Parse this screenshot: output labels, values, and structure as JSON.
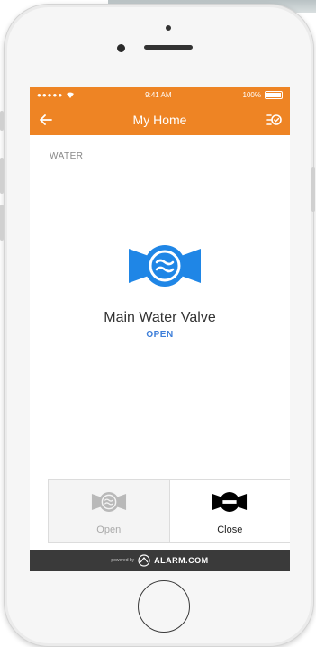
{
  "status_bar": {
    "signal": "●●●●●",
    "time": "9:41 AM",
    "battery": "100%"
  },
  "navbar": {
    "title": "My Home"
  },
  "section_label": "WATER",
  "device": {
    "name": "Main Water Valve",
    "state": "OPEN"
  },
  "controls": {
    "open_label": "Open",
    "close_label": "Close"
  },
  "footer": {
    "powered_by": "powered by",
    "brand": "ALARM.COM"
  },
  "colors": {
    "accent": "#ee8424",
    "valve_blue": "#1f86e6",
    "state_blue": "#3d7ed9",
    "footer_bg": "#3a3a3a"
  },
  "icons": {
    "back": "arrow-left-icon",
    "action": "checklist-icon",
    "valve": "water-valve-icon"
  }
}
